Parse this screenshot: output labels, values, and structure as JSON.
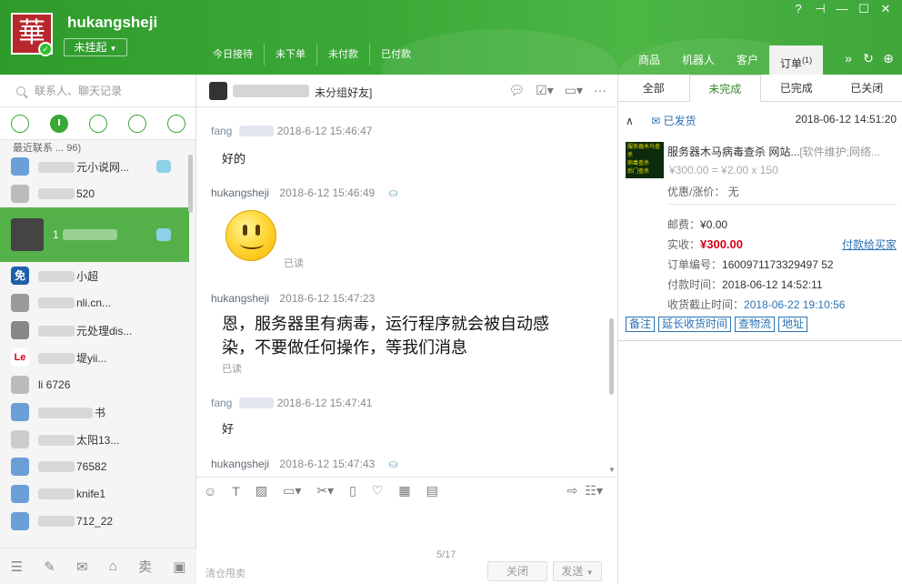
{
  "header": {
    "logo_char": "華",
    "username": "hukangsheji",
    "status": "未挂起",
    "quick_tabs": [
      "今日接待",
      "未下单",
      "未付款",
      "已付款"
    ],
    "main_tabs": [
      {
        "label": "商品"
      },
      {
        "label": "机器人"
      },
      {
        "label": "客户"
      },
      {
        "label": "订单",
        "count": "(1)"
      }
    ]
  },
  "left": {
    "search_placeholder": "联系人、聊天记录",
    "group_header": "最近联系 ... 96)",
    "contacts": [
      {
        "name": "元小说网...",
        "color": "#6a9fd6",
        "badge": true
      },
      {
        "name": "520",
        "color": "#bbbbbb",
        "badge": false
      },
      {
        "name": "1",
        "selected": true,
        "badge": true
      },
      {
        "name": "小超",
        "color": "#1d5fa8",
        "badge": false,
        "icon_text": "免"
      },
      {
        "name": "nli.cn...",
        "color": "#9a9a9a",
        "badge": false
      },
      {
        "name": "元处理dis...",
        "color": "#888888",
        "badge": false
      },
      {
        "name": "堤yii...",
        "color": "#ffffff",
        "badge": false,
        "icon_text": "Le"
      },
      {
        "name": "li 6726",
        "color": "#bbbbbb",
        "badge": false
      },
      {
        "name": "书",
        "color": "#6a9fd6",
        "badge": false
      },
      {
        "name": "太阳13...",
        "color": "#cccccc",
        "badge": false
      },
      {
        "name": "76582",
        "color": "#6a9fd6",
        "badge": false
      },
      {
        "name": "knife1",
        "color": "#6a9fd6",
        "badge": false
      },
      {
        "name": "712_22",
        "color": "#6a9fd6",
        "badge": false
      }
    ]
  },
  "chat": {
    "title_suffix": "未分组好友]",
    "messages": [
      {
        "sender": "fang",
        "time": "2018-6-12 15:46:47",
        "text": "好的"
      },
      {
        "sender": "hukangsheji",
        "time": "2018-6-12 15:46:49",
        "read": "已读"
      },
      {
        "sender": "hukangsheji",
        "time": "2018-6-12 15:47:23",
        "text": "恩，服务器里有病毒，运行程序就会被自动感染，不要做任何操作，等我们消息",
        "read": "已读"
      },
      {
        "sender": "fang",
        "time": "2018-6-12 15:47:41",
        "text": "好"
      },
      {
        "sender": "hukangsheji",
        "time": "2018-6-12 15:47:43"
      }
    ],
    "counter": "5/17",
    "clear_link": "清仓甩卖",
    "close_label": "关闭",
    "send_label": "发送"
  },
  "orders": {
    "tabs": [
      "全部",
      "未完成",
      "已完成",
      "已关闭"
    ],
    "active_tab": 1,
    "order": {
      "status": "已发货",
      "time": "2018-06-12 14:51:20",
      "product": "服务器木马病毒查杀 网站...",
      "product_tag": "[软件维护;网络...",
      "price": "¥300.00 = ¥2.00 x 150",
      "promo_label": "优惠/涨价：",
      "promo_value": "无",
      "postage_label": "邮费：",
      "postage": "¥0.00",
      "received_label": "实收：",
      "received": "¥300.00",
      "pay_link": "付款给买家",
      "order_no_label": "订单编号：",
      "order_no": "1600971173329497 52",
      "pay_time_label": "付款时间：",
      "pay_time": "2018-06-12 14:52:11",
      "deadline_label": "收货截止时间：",
      "deadline": "2018-06-22 19:10:56",
      "actions": [
        "备注",
        "延长收货时间",
        "查物流",
        "地址"
      ]
    }
  }
}
